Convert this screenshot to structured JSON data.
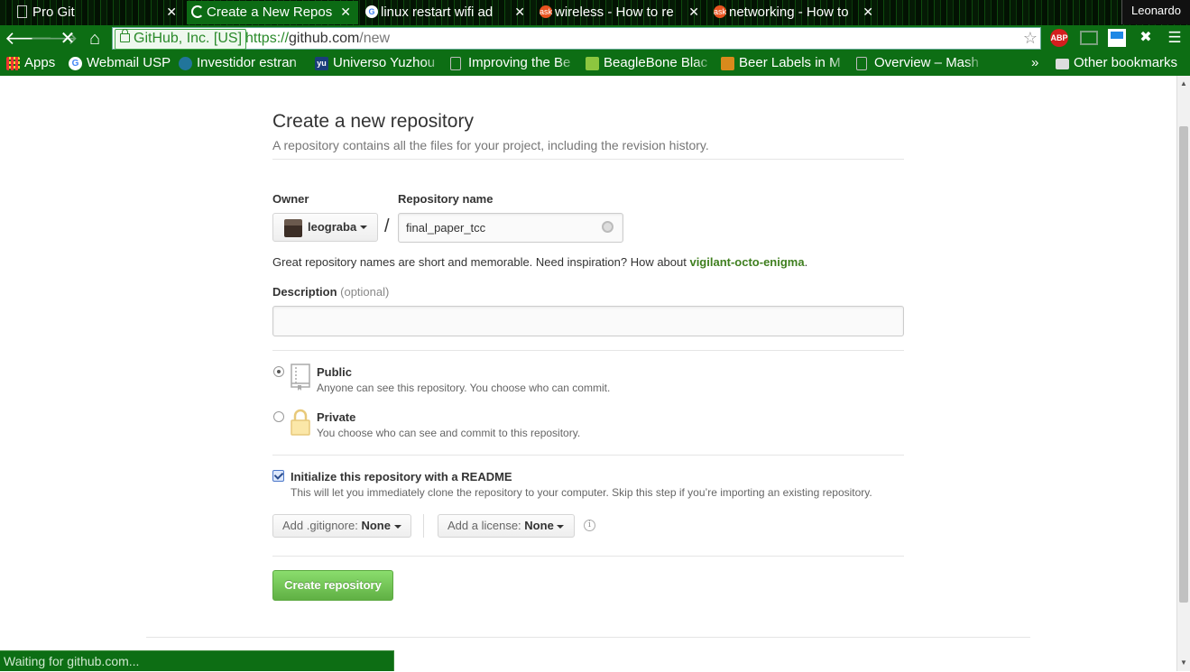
{
  "browser": {
    "tabs": [
      {
        "title": "Pro Git",
        "icon": "page-icon",
        "active": false
      },
      {
        "title": "Create a New Repos",
        "icon": "loading-spinner-icon",
        "active": true
      },
      {
        "title": "linux restart wifi ad",
        "icon": "google-icon",
        "active": false
      },
      {
        "title": "wireless - How to re",
        "icon": "askubuntu-icon",
        "active": false
      },
      {
        "title": "networking - How to",
        "icon": "askubuntu-icon",
        "active": false
      }
    ],
    "profile_name": "Leonardo",
    "ev_label": "GitHub, Inc. [US]",
    "url_scheme": "https://",
    "url_host": "github.com",
    "url_path": "/new",
    "extensions": [
      "abp-icon",
      "cast-icon",
      "screen-icon",
      "xmark-icon",
      "menu-icon"
    ],
    "abp_label": "ABP",
    "bookmarks": [
      {
        "label": "Apps",
        "icon": "apps-grid-icon"
      },
      {
        "label": "Webmail USP",
        "icon": "google-icon"
      },
      {
        "label": "Investidor estran",
        "icon": "wordpress-icon"
      },
      {
        "label": "Universo Yuzhou",
        "icon": "yu-icon"
      },
      {
        "label": "Improving the Be",
        "icon": "page-icon"
      },
      {
        "label": "BeagleBone Blac",
        "icon": "beaglebone-icon"
      },
      {
        "label": "Beer Labels in M",
        "icon": "beer-icon"
      },
      {
        "label": "Overview – Mash",
        "icon": "page-icon"
      }
    ],
    "bookmarks_overflow": "»",
    "other_bookmarks": "Other bookmarks",
    "status_text": "Waiting for github.com...",
    "colors": {
      "frame": "#0d6e14",
      "active_tab": "#0c6b14"
    }
  },
  "page": {
    "title": "Create a new repository",
    "subtitle": "A repository contains all the files for your project, including the revision history.",
    "owner_label": "Owner",
    "owner_value": "leograba",
    "separator": "/",
    "repo_name_label": "Repository name",
    "repo_name_value": "final_paper_tcc",
    "hint_prefix": "Great repository names are short and memorable. Need inspiration? How about ",
    "hint_suggestion": "vigilant-octo-enigma",
    "hint_suffix": ".",
    "description_label": "Description",
    "description_optional": "(optional)",
    "description_value": "",
    "visibility": [
      {
        "title": "Public",
        "note": "Anyone can see this repository. You choose who can commit.",
        "selected": true,
        "icon": "repo-book-icon"
      },
      {
        "title": "Private",
        "note": "You choose who can see and commit to this repository.",
        "selected": false,
        "icon": "lock-icon"
      }
    ],
    "readme_label": "Initialize this repository with a README",
    "readme_note": "This will let you immediately clone the repository to your computer. Skip this step if you’re importing an existing repository.",
    "readme_checked": true,
    "gitignore_label": "Add .gitignore:",
    "gitignore_value": "None",
    "license_label": "Add a license:",
    "license_value": "None",
    "create_button": "Create repository",
    "colors": {
      "primary_button": "#60b044",
      "suggestion": "#3f7f1f"
    }
  }
}
